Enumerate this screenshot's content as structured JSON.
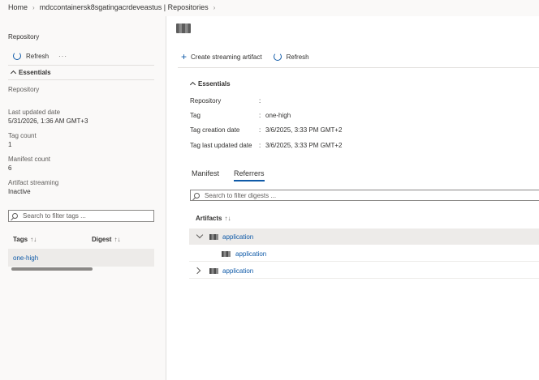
{
  "breadcrumb": {
    "items": [
      "Home",
      "mdccontainersk8sgatingacrdeveastus | Repositories"
    ]
  },
  "left_panel": {
    "blade_title": "Repository",
    "toolbar": {
      "refresh_label": "Refresh",
      "more_label": "···"
    },
    "essentials": {
      "header": "Essentials",
      "section_title": "Repository",
      "fields": [
        {
          "label": "Last updated date",
          "value": "5/31/2026, 1:36 AM GMT+3"
        },
        {
          "label": "Tag count",
          "value": "1"
        },
        {
          "label": "Manifest count",
          "value": "6"
        },
        {
          "label": "Artifact streaming",
          "value": "Inactive"
        }
      ]
    },
    "filter_placeholder": "Search to filter tags ...",
    "columns": {
      "tags": "Tags",
      "digest": "Digest",
      "sort_icon": "↑↓"
    },
    "rows": [
      {
        "tag": "one-high"
      }
    ]
  },
  "right_panel": {
    "toolbar": {
      "create_label": "Create streaming artifact",
      "refresh_label": "Refresh"
    },
    "essentials": {
      "header": "Essentials",
      "fields": [
        {
          "label": "Repository",
          "value": ""
        },
        {
          "label": "Tag",
          "value": "one-high"
        },
        {
          "label": "Tag creation date",
          "value": "3/6/2025, 3:33 PM GMT+2"
        },
        {
          "label": "Tag last updated date",
          "value": "3/6/2025, 3:33 PM GMT+2"
        }
      ]
    },
    "tabs": [
      {
        "label": "Manifest",
        "active": false
      },
      {
        "label": "Referrers",
        "active": true
      }
    ],
    "filter_placeholder": "Search to filter digests ...",
    "artifacts_header": "Artifacts",
    "sort_icon": "↑↓",
    "tree": [
      {
        "label": "application",
        "state": "expanded",
        "selected": true
      },
      {
        "label": "application",
        "state": "child"
      },
      {
        "label": "application",
        "state": "collapsed"
      }
    ]
  },
  "colors": {
    "accent": "#0f5aa8",
    "selected_row": "#edebe9"
  }
}
